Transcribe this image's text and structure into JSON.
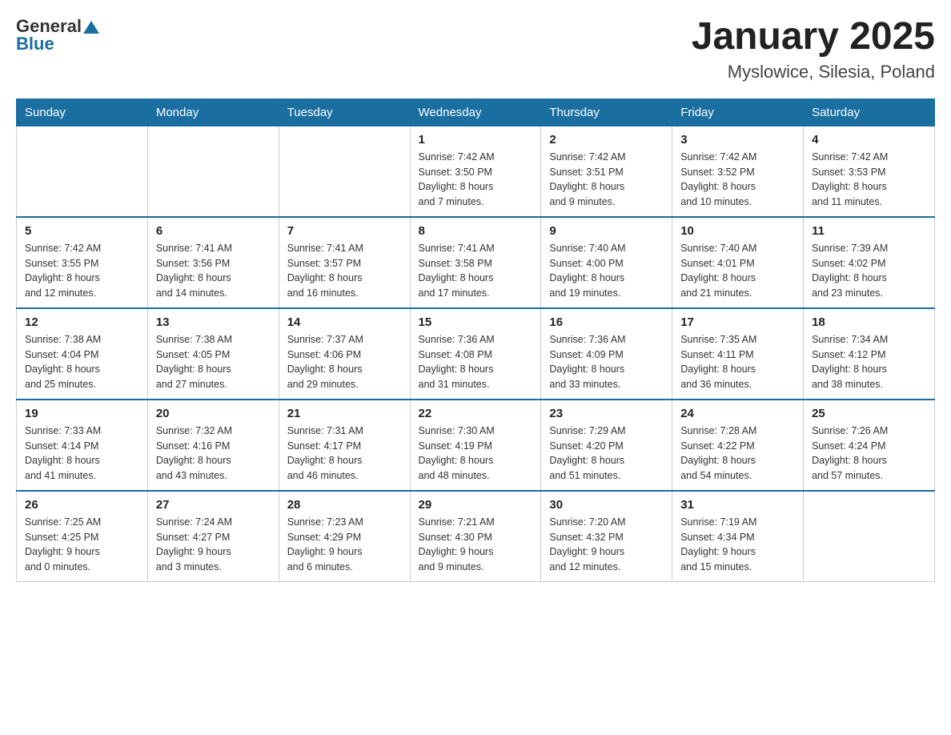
{
  "header": {
    "logo_general": "General",
    "logo_blue": "Blue",
    "month_title": "January 2025",
    "location": "Myslowice, Silesia, Poland"
  },
  "days_of_week": [
    "Sunday",
    "Monday",
    "Tuesday",
    "Wednesday",
    "Thursday",
    "Friday",
    "Saturday"
  ],
  "weeks": [
    [
      {
        "day": "",
        "info": ""
      },
      {
        "day": "",
        "info": ""
      },
      {
        "day": "",
        "info": ""
      },
      {
        "day": "1",
        "info": "Sunrise: 7:42 AM\nSunset: 3:50 PM\nDaylight: 8 hours\nand 7 minutes."
      },
      {
        "day": "2",
        "info": "Sunrise: 7:42 AM\nSunset: 3:51 PM\nDaylight: 8 hours\nand 9 minutes."
      },
      {
        "day": "3",
        "info": "Sunrise: 7:42 AM\nSunset: 3:52 PM\nDaylight: 8 hours\nand 10 minutes."
      },
      {
        "day": "4",
        "info": "Sunrise: 7:42 AM\nSunset: 3:53 PM\nDaylight: 8 hours\nand 11 minutes."
      }
    ],
    [
      {
        "day": "5",
        "info": "Sunrise: 7:42 AM\nSunset: 3:55 PM\nDaylight: 8 hours\nand 12 minutes."
      },
      {
        "day": "6",
        "info": "Sunrise: 7:41 AM\nSunset: 3:56 PM\nDaylight: 8 hours\nand 14 minutes."
      },
      {
        "day": "7",
        "info": "Sunrise: 7:41 AM\nSunset: 3:57 PM\nDaylight: 8 hours\nand 16 minutes."
      },
      {
        "day": "8",
        "info": "Sunrise: 7:41 AM\nSunset: 3:58 PM\nDaylight: 8 hours\nand 17 minutes."
      },
      {
        "day": "9",
        "info": "Sunrise: 7:40 AM\nSunset: 4:00 PM\nDaylight: 8 hours\nand 19 minutes."
      },
      {
        "day": "10",
        "info": "Sunrise: 7:40 AM\nSunset: 4:01 PM\nDaylight: 8 hours\nand 21 minutes."
      },
      {
        "day": "11",
        "info": "Sunrise: 7:39 AM\nSunset: 4:02 PM\nDaylight: 8 hours\nand 23 minutes."
      }
    ],
    [
      {
        "day": "12",
        "info": "Sunrise: 7:38 AM\nSunset: 4:04 PM\nDaylight: 8 hours\nand 25 minutes."
      },
      {
        "day": "13",
        "info": "Sunrise: 7:38 AM\nSunset: 4:05 PM\nDaylight: 8 hours\nand 27 minutes."
      },
      {
        "day": "14",
        "info": "Sunrise: 7:37 AM\nSunset: 4:06 PM\nDaylight: 8 hours\nand 29 minutes."
      },
      {
        "day": "15",
        "info": "Sunrise: 7:36 AM\nSunset: 4:08 PM\nDaylight: 8 hours\nand 31 minutes."
      },
      {
        "day": "16",
        "info": "Sunrise: 7:36 AM\nSunset: 4:09 PM\nDaylight: 8 hours\nand 33 minutes."
      },
      {
        "day": "17",
        "info": "Sunrise: 7:35 AM\nSunset: 4:11 PM\nDaylight: 8 hours\nand 36 minutes."
      },
      {
        "day": "18",
        "info": "Sunrise: 7:34 AM\nSunset: 4:12 PM\nDaylight: 8 hours\nand 38 minutes."
      }
    ],
    [
      {
        "day": "19",
        "info": "Sunrise: 7:33 AM\nSunset: 4:14 PM\nDaylight: 8 hours\nand 41 minutes."
      },
      {
        "day": "20",
        "info": "Sunrise: 7:32 AM\nSunset: 4:16 PM\nDaylight: 8 hours\nand 43 minutes."
      },
      {
        "day": "21",
        "info": "Sunrise: 7:31 AM\nSunset: 4:17 PM\nDaylight: 8 hours\nand 46 minutes."
      },
      {
        "day": "22",
        "info": "Sunrise: 7:30 AM\nSunset: 4:19 PM\nDaylight: 8 hours\nand 48 minutes."
      },
      {
        "day": "23",
        "info": "Sunrise: 7:29 AM\nSunset: 4:20 PM\nDaylight: 8 hours\nand 51 minutes."
      },
      {
        "day": "24",
        "info": "Sunrise: 7:28 AM\nSunset: 4:22 PM\nDaylight: 8 hours\nand 54 minutes."
      },
      {
        "day": "25",
        "info": "Sunrise: 7:26 AM\nSunset: 4:24 PM\nDaylight: 8 hours\nand 57 minutes."
      }
    ],
    [
      {
        "day": "26",
        "info": "Sunrise: 7:25 AM\nSunset: 4:25 PM\nDaylight: 9 hours\nand 0 minutes."
      },
      {
        "day": "27",
        "info": "Sunrise: 7:24 AM\nSunset: 4:27 PM\nDaylight: 9 hours\nand 3 minutes."
      },
      {
        "day": "28",
        "info": "Sunrise: 7:23 AM\nSunset: 4:29 PM\nDaylight: 9 hours\nand 6 minutes."
      },
      {
        "day": "29",
        "info": "Sunrise: 7:21 AM\nSunset: 4:30 PM\nDaylight: 9 hours\nand 9 minutes."
      },
      {
        "day": "30",
        "info": "Sunrise: 7:20 AM\nSunset: 4:32 PM\nDaylight: 9 hours\nand 12 minutes."
      },
      {
        "day": "31",
        "info": "Sunrise: 7:19 AM\nSunset: 4:34 PM\nDaylight: 9 hours\nand 15 minutes."
      },
      {
        "day": "",
        "info": ""
      }
    ]
  ]
}
